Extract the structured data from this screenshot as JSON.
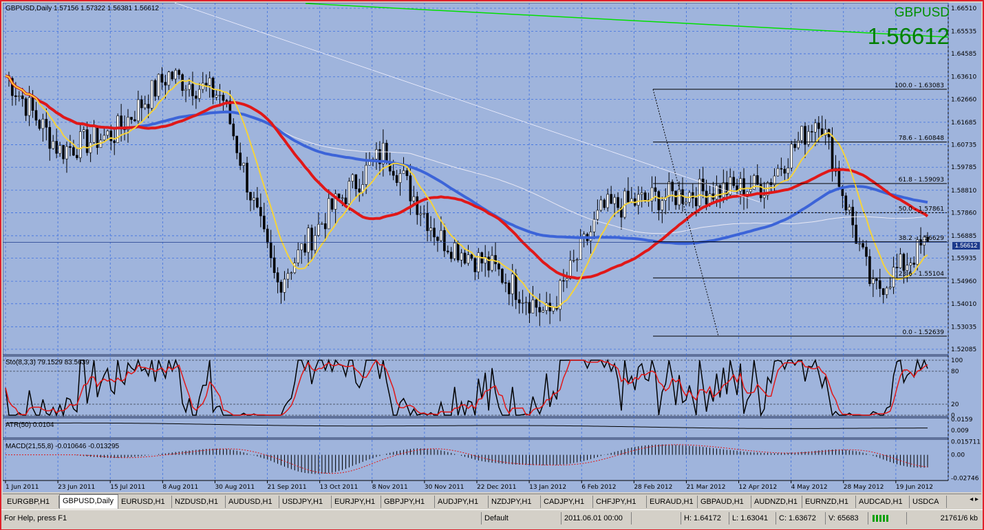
{
  "window": {
    "header": "GBPUSD,Daily  1.57156 1.57322 1.56381 1.56612",
    "symbol": "GBPUSD",
    "big_price": "1.56612",
    "current_price_tag": "1.56612"
  },
  "indicators": {
    "stochastic": "Sto(8,3,3) 79.1529 83.5639",
    "atr": "ATR(50) 0.0104",
    "macd": "MACD(21,55,8) -0.010646 -0.013295"
  },
  "price_axis": [
    "1.66510",
    "1.65535",
    "1.64585",
    "1.63610",
    "1.62660",
    "1.61685",
    "1.60735",
    "1.59785",
    "1.58810",
    "1.57860",
    "1.56885",
    "1.55935",
    "1.54960",
    "1.54010",
    "1.53035",
    "1.52085"
  ],
  "sto_axis": [
    "100",
    "80",
    "20",
    "0"
  ],
  "atr_axis": [
    "0.0159",
    "0.009"
  ],
  "macd_axis": [
    "0.015711",
    "0.00",
    "-0.02746"
  ],
  "date_axis": [
    "1 Jun 2011",
    "23 Jun 2011",
    "15 Jul 2011",
    "8 Aug 2011",
    "30 Aug 2011",
    "21 Sep 2011",
    "13 Oct 2011",
    "8 Nov 2011",
    "30 Nov 2011",
    "22 Dec 2011",
    "13 Jan 2012",
    "6 Feb 2012",
    "28 Feb 2012",
    "21 Mar 2012",
    "12 Apr 2012",
    "4 May 2012",
    "28 May 2012",
    "19 Jun 2012"
  ],
  "fibonacci": [
    "100.0 - 1.63083",
    "78.6 - 1.60848",
    "61.8 - 1.59093",
    "50.0 - 1.57861",
    "38.2 - 1.56629",
    "23.6 - 1.55104",
    "0.0 - 1.52639"
  ],
  "tabs": [
    "EURGBP,H1",
    "GBPUSD,Daily",
    "EURUSD,H1",
    "NZDUSD,H1",
    "AUDUSD,H1",
    "USDJPY,H1",
    "EURJPY,H1",
    "GBPJPY,H1",
    "AUDJPY,H1",
    "NZDJPY,H1",
    "CADJPY,H1",
    "CHFJPY,H1",
    "EURAUD,H1",
    "GBPAUD,H1",
    "AUDNZD,H1",
    "EURNZD,H1",
    "AUDCAD,H1",
    "USDCA"
  ],
  "tab_nav": "◂ ▸",
  "status": {
    "help": "For Help, press F1",
    "profile": "Default",
    "datetime": "2011.06.01 00:00",
    "high": "H: 1.64172",
    "low": "L: 1.63041",
    "close": "C: 1.63672",
    "volume": "V: 65683",
    "traffic": "21761/6 kb"
  },
  "chart_data": {
    "type": "candlestick",
    "symbol": "GBPUSD",
    "timeframe": "Daily",
    "ohlc_last": {
      "open": 1.57156,
      "high": 1.57322,
      "low": 1.56381,
      "close": 1.56612
    },
    "close_path": [
      [
        "1 Jun 2011",
        1.6367
      ],
      [
        "23 Jun 2011",
        1.605
      ],
      [
        "15 Jul 2011",
        1.612
      ],
      [
        "8 Aug 2011",
        1.637
      ],
      [
        "30 Aug 2011",
        1.628
      ],
      [
        "21 Sep 2011",
        1.548
      ],
      [
        "13 Oct 2011",
        1.58
      ],
      [
        "8 Nov 2011",
        1.605
      ],
      [
        "30 Nov 2011",
        1.568
      ],
      [
        "22 Dec 2011",
        1.555
      ],
      [
        "13 Jan 2012",
        1.535
      ],
      [
        "6 Feb 2012",
        1.58
      ],
      [
        "28 Feb 2012",
        1.585
      ],
      [
        "21 Mar 2012",
        1.588
      ],
      [
        "12 Apr 2012",
        1.59
      ],
      [
        "4 May 2012",
        1.62
      ],
      [
        "28 May 2012",
        1.545
      ],
      [
        "19 Jun 2012",
        1.5661
      ]
    ],
    "y_range": [
      1.52085,
      1.6651
    ],
    "fib_levels": [
      {
        "pct": 100.0,
        "price": 1.63083
      },
      {
        "pct": 78.6,
        "price": 1.60848
      },
      {
        "pct": 61.8,
        "price": 1.59093
      },
      {
        "pct": 50.0,
        "price": 1.57861
      },
      {
        "pct": 38.2,
        "price": 1.56629
      },
      {
        "pct": 23.6,
        "price": 1.55104
      },
      {
        "pct": 0.0,
        "price": 1.52639
      }
    ],
    "colors": {
      "background": "#9fb4dc",
      "ma_fast": "#f5d33a",
      "ma_mid": "#e01818",
      "ma_slow": "#3c64d8",
      "trendline": "#00e000",
      "stoch_main": "#000000",
      "stoch_signal": "#e01818"
    }
  }
}
